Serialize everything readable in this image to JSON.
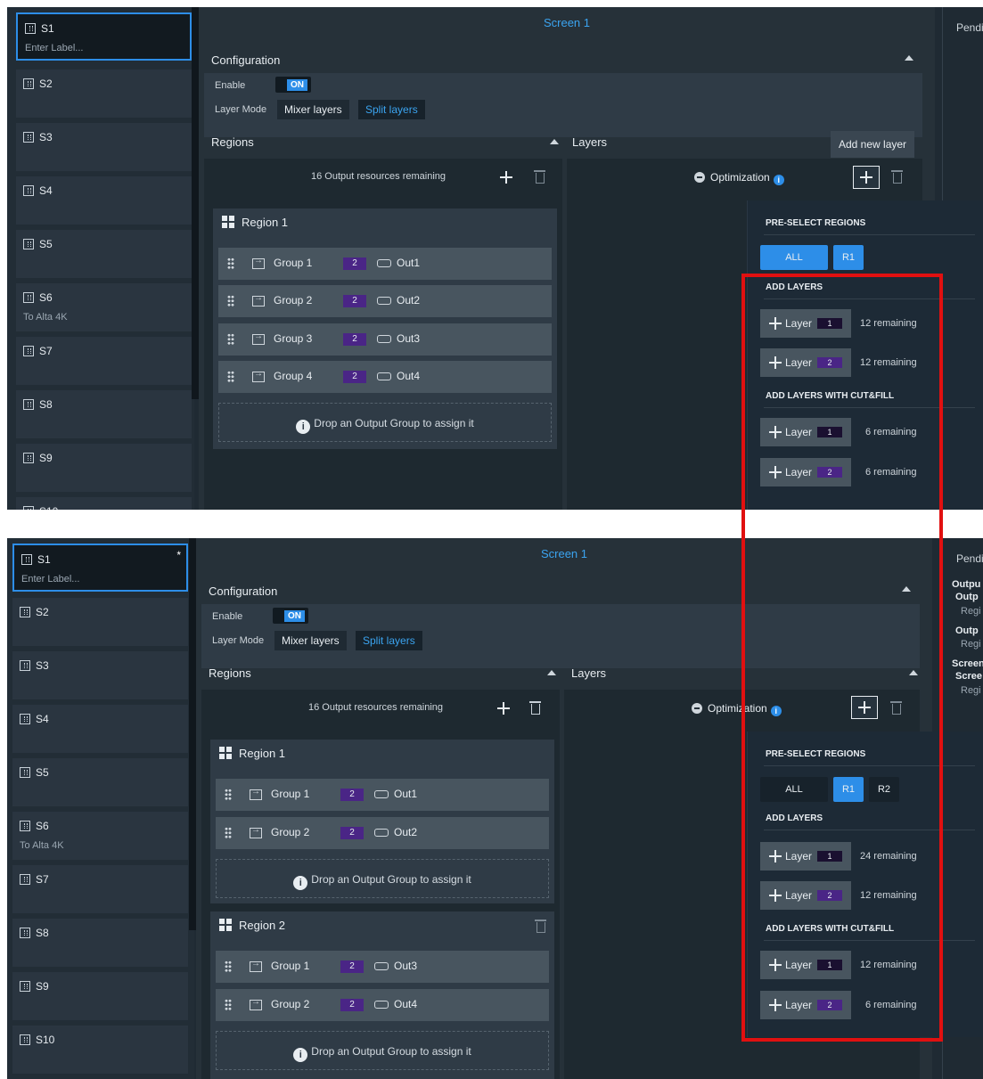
{
  "sidebar": {
    "items": [
      {
        "name": "S1",
        "sub": "Enter Label..."
      },
      {
        "name": "S2",
        "sub": ""
      },
      {
        "name": "S3",
        "sub": ""
      },
      {
        "name": "S4",
        "sub": ""
      },
      {
        "name": "S5",
        "sub": ""
      },
      {
        "name": "S6",
        "sub": "To Alta 4K"
      },
      {
        "name": "S7",
        "sub": ""
      },
      {
        "name": "S8",
        "sub": ""
      },
      {
        "name": "S9",
        "sub": ""
      },
      {
        "name": "S10",
        "sub": ""
      }
    ],
    "modified_marker": "*"
  },
  "screen_title": "Screen 1",
  "configuration": {
    "title": "Configuration",
    "enable_label": "Enable",
    "enable_value": "ON",
    "layer_mode_label": "Layer Mode",
    "mixer_label": "Mixer layers",
    "split_label": "Split layers"
  },
  "regions": {
    "title": "Regions",
    "resources": "16 Output resources remaining",
    "drop_text": "Drop an Output Group to assign it"
  },
  "layers": {
    "title": "Layers",
    "optimization": "Optimization",
    "tooltip": "Add new layer"
  },
  "right_panel": {
    "pending": "Pendi",
    "lines": [
      "Outpu",
      "Outp",
      "Regi",
      "Outp",
      "Regi",
      "Screen",
      "Scree",
      "Regi"
    ]
  },
  "before": {
    "region": {
      "name": "Region 1",
      "groups": [
        {
          "group": "Group 1",
          "count": "2",
          "output": "Out1"
        },
        {
          "group": "Group 2",
          "count": "2",
          "output": "Out2"
        },
        {
          "group": "Group 3",
          "count": "2",
          "output": "Out3"
        },
        {
          "group": "Group 4",
          "count": "2",
          "output": "Out4"
        }
      ]
    },
    "popup": {
      "preselect": "PRE-SELECT REGIONS",
      "chips": [
        "ALL",
        "R1"
      ],
      "add_layers": "ADD LAYERS",
      "add_cutfill": "ADD LAYERS WITH CUT&FILL",
      "layer_label": "Layer",
      "rows": [
        {
          "badge": "1",
          "remaining": "12 remaining"
        },
        {
          "badge": "2",
          "remaining": "12 remaining"
        },
        {
          "badge": "1",
          "remaining": "6 remaining"
        },
        {
          "badge": "2",
          "remaining": "6 remaining"
        }
      ]
    }
  },
  "after": {
    "regions": [
      {
        "name": "Region 1",
        "groups": [
          {
            "group": "Group 1",
            "count": "2",
            "output": "Out1"
          },
          {
            "group": "Group 2",
            "count": "2",
            "output": "Out2"
          }
        ]
      },
      {
        "name": "Region 2",
        "groups": [
          {
            "group": "Group 1",
            "count": "2",
            "output": "Out3"
          },
          {
            "group": "Group 2",
            "count": "2",
            "output": "Out4"
          }
        ]
      }
    ],
    "popup": {
      "preselect": "PRE-SELECT REGIONS",
      "chips": [
        "ALL",
        "R1",
        "R2"
      ],
      "add_layers": "ADD LAYERS",
      "add_cutfill": "ADD LAYERS WITH CUT&FILL",
      "layer_label": "Layer",
      "rows": [
        {
          "badge": "1",
          "remaining": "24 remaining"
        },
        {
          "badge": "2",
          "remaining": "12 remaining"
        },
        {
          "badge": "1",
          "remaining": "12 remaining"
        },
        {
          "badge": "2",
          "remaining": "6 remaining"
        }
      ]
    }
  },
  "colors": {
    "accent": "#2d8ee8",
    "badge_purple": "#4a2586",
    "highlight_red": "#e11010",
    "panel_bg": "#263139"
  }
}
